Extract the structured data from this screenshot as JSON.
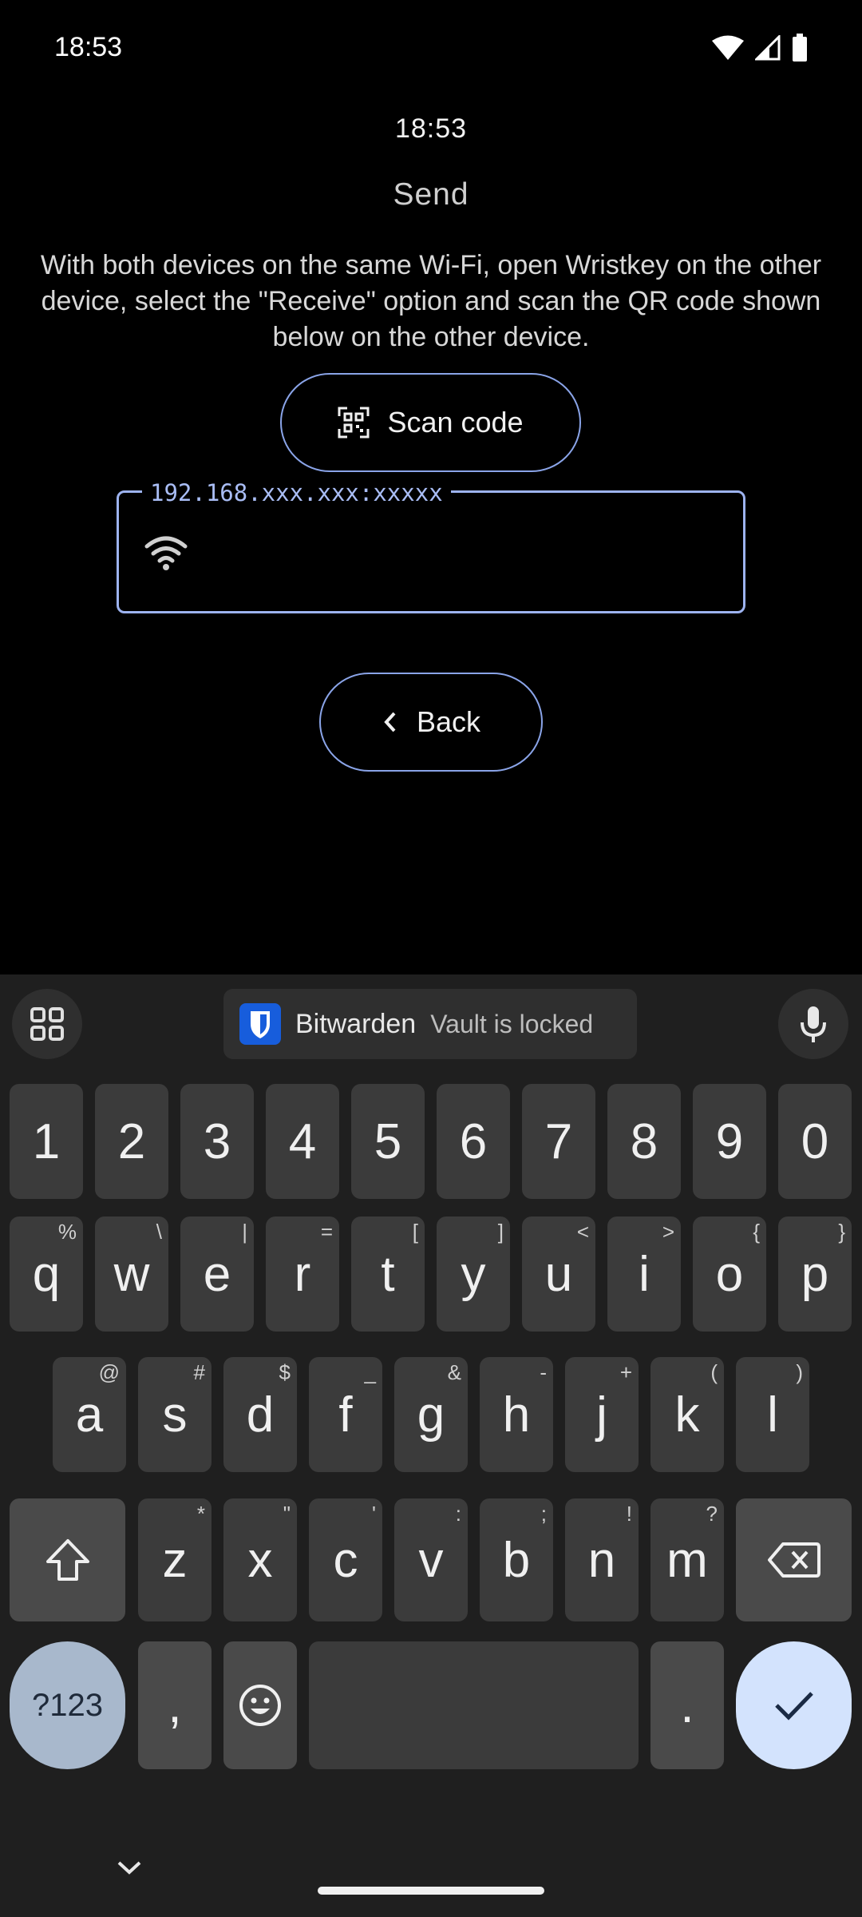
{
  "status_bar": {
    "time": "18:53",
    "icons": [
      "wifi-icon",
      "cell-signal-icon",
      "battery-icon"
    ]
  },
  "screen": {
    "clock": "18:53",
    "title": "Send",
    "instructions": "With both devices on the same Wi-Fi, open Wristkey on the other device, select the \"Receive\" option and scan the QR code shown below on the other device.",
    "scan_button_label": "Scan code",
    "address_label": "192.168.xxx.xxx:xxxxx",
    "address_value": "",
    "back_button_label": "Back"
  },
  "keyboard": {
    "suggestion": {
      "app": "Bitwarden",
      "status": "Vault is locked"
    },
    "number_row": [
      "1",
      "2",
      "3",
      "4",
      "5",
      "6",
      "7",
      "8",
      "9",
      "0"
    ],
    "row1": [
      {
        "key": "q",
        "hint": "%"
      },
      {
        "key": "w",
        "hint": "\\"
      },
      {
        "key": "e",
        "hint": "|"
      },
      {
        "key": "r",
        "hint": "="
      },
      {
        "key": "t",
        "hint": "["
      },
      {
        "key": "y",
        "hint": "]"
      },
      {
        "key": "u",
        "hint": "<"
      },
      {
        "key": "i",
        "hint": ">"
      },
      {
        "key": "o",
        "hint": "{"
      },
      {
        "key": "p",
        "hint": "}"
      }
    ],
    "row2": [
      {
        "key": "a",
        "hint": "@"
      },
      {
        "key": "s",
        "hint": "#"
      },
      {
        "key": "d",
        "hint": "$"
      },
      {
        "key": "f",
        "hint": "_"
      },
      {
        "key": "g",
        "hint": "&"
      },
      {
        "key": "h",
        "hint": "-"
      },
      {
        "key": "j",
        "hint": "+"
      },
      {
        "key": "k",
        "hint": "("
      },
      {
        "key": "l",
        "hint": ")"
      }
    ],
    "row3": [
      {
        "key": "z",
        "hint": "*"
      },
      {
        "key": "x",
        "hint": "\""
      },
      {
        "key": "c",
        "hint": "'"
      },
      {
        "key": "v",
        "hint": ":"
      },
      {
        "key": "b",
        "hint": ";"
      },
      {
        "key": "n",
        "hint": "!"
      },
      {
        "key": "m",
        "hint": "?"
      }
    ],
    "symbols_key": "?123",
    "comma_key": ",",
    "period_key": ".",
    "accent_color": "#d3e3fd"
  }
}
